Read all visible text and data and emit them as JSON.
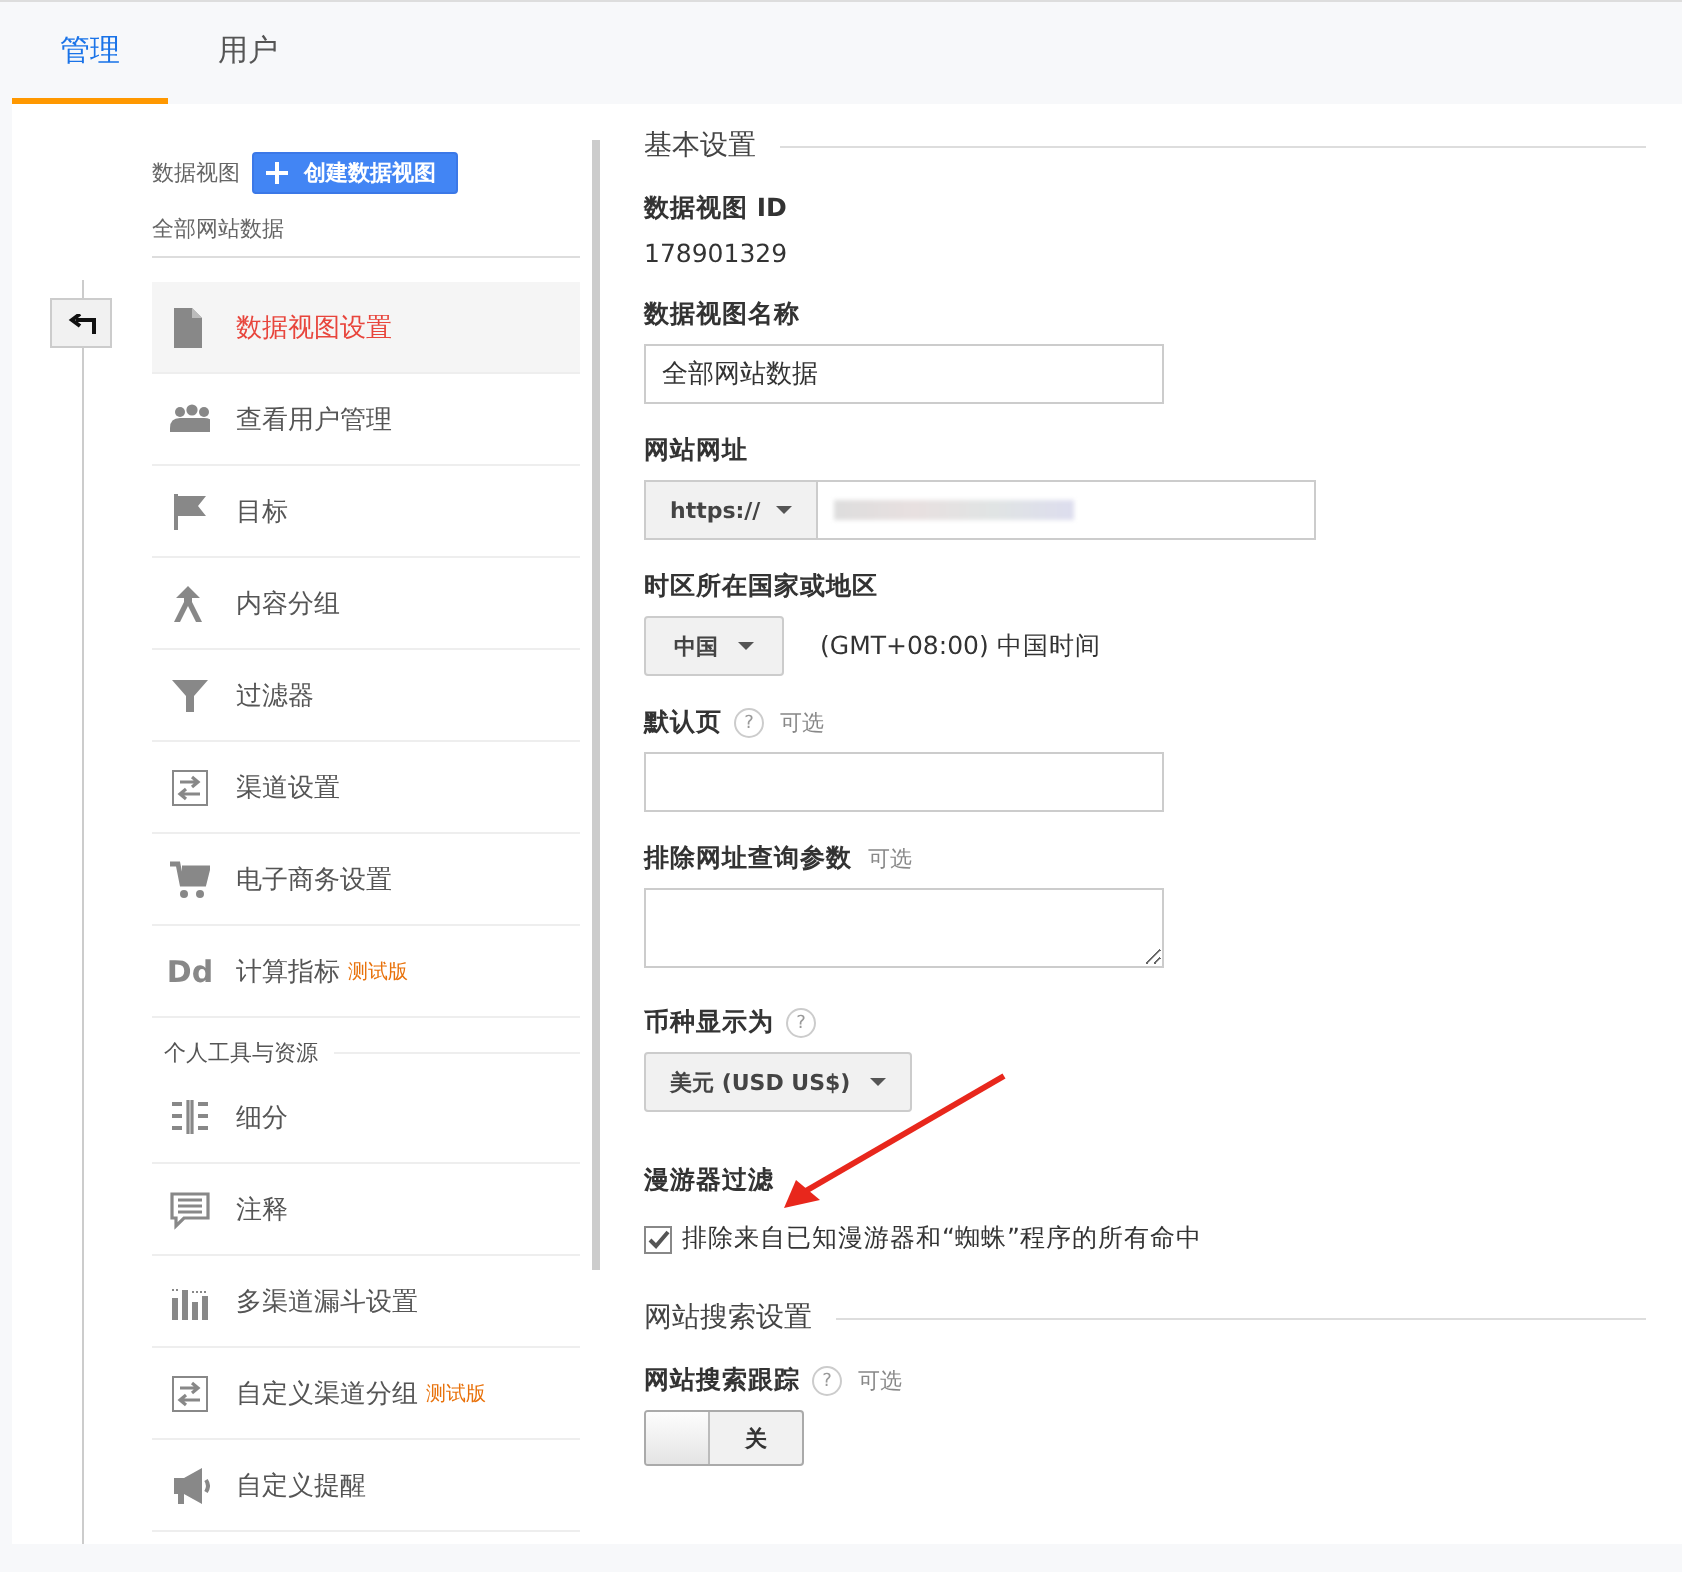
{
  "tabs": [
    {
      "label": "管理",
      "selected": true
    },
    {
      "label": "用户",
      "selected": false
    }
  ],
  "view_selector": {
    "label": "数据视图",
    "create_button": "创建数据视图",
    "current_view": "全部网站数据"
  },
  "nav_groups": [
    {
      "items": [
        {
          "label": "数据视图设置",
          "selected": true
        },
        {
          "label": "查看用户管理",
          "selected": false
        },
        {
          "label": "目标",
          "selected": false
        },
        {
          "label": "内容分组",
          "selected": false
        },
        {
          "label": "过滤器",
          "selected": false
        },
        {
          "label": "渠道设置",
          "selected": false
        },
        {
          "label": "电子商务设置",
          "selected": false
        },
        {
          "label": "计算指标",
          "icon_text": "Dd",
          "badge": "测试版",
          "selected": false
        }
      ]
    },
    {
      "title": "个人工具与资源",
      "items": [
        {
          "label": "细分",
          "selected": false
        },
        {
          "label": "注释",
          "selected": false
        },
        {
          "label": "多渠道漏斗设置",
          "selected": false
        },
        {
          "label": "自定义渠道分组",
          "badge": "测试版",
          "selected": false
        },
        {
          "label": "自定义提醒",
          "selected": false
        }
      ]
    }
  ],
  "sections": [
    {
      "title": "基本设置",
      "fields": [
        {
          "kind": "text",
          "label": "数据视图 ID",
          "value": "178901329"
        },
        {
          "kind": "input",
          "label": "数据视图名称",
          "value": "全部网站数据"
        },
        {
          "kind": "url",
          "label": "网站网址",
          "prefix": "https://"
        },
        {
          "kind": "select",
          "label": "时区所在国家或地区",
          "value": "中国",
          "note": "(GMT+08:00) 中国时间"
        },
        {
          "kind": "input",
          "label": "默认页",
          "help": "?",
          "optional": "可选"
        },
        {
          "kind": "textarea",
          "label": "排除网址查询参数",
          "optional": "可选"
        },
        {
          "kind": "select",
          "label": "币种显示为",
          "help": "?",
          "value": "美元 (USD US$)"
        },
        {
          "kind": "checkbox",
          "label": "漫游器过滤",
          "text": "排除来自已知漫游器和“蜘蛛”程序的所有命中",
          "checked": true
        }
      ]
    },
    {
      "title": "网站搜索设置",
      "fields": [
        {
          "kind": "toggle",
          "label": "网站搜索跟踪",
          "help": "?",
          "optional": "可选",
          "value": "关",
          "on": false
        }
      ]
    }
  ]
}
